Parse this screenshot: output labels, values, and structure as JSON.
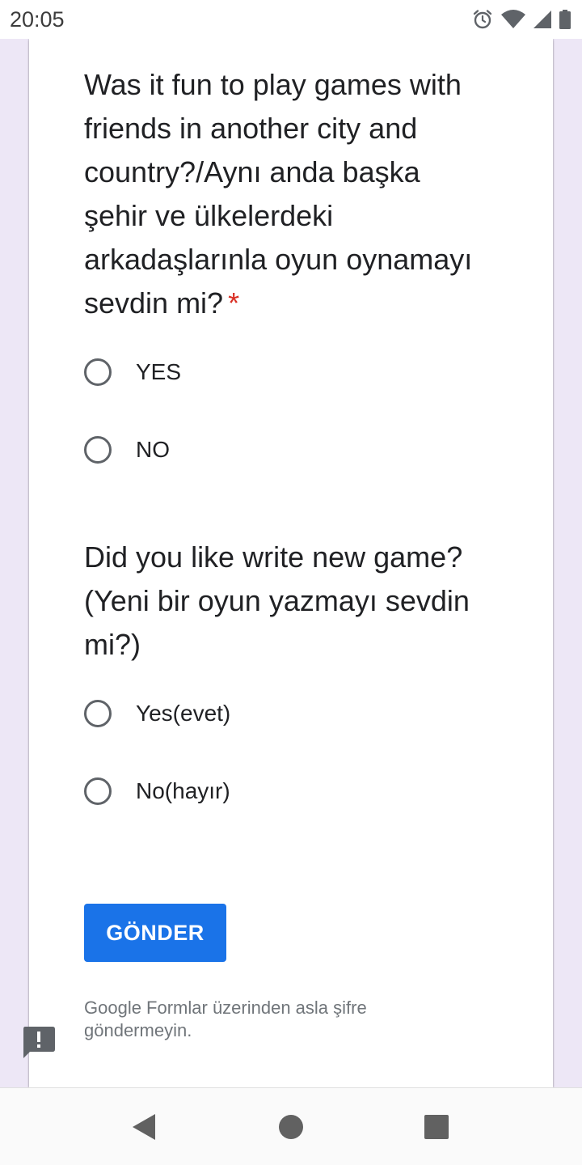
{
  "status_bar": {
    "time": "20:05",
    "icons": [
      "alarm-icon",
      "wifi-icon",
      "cell-signal-icon",
      "battery-icon"
    ]
  },
  "form": {
    "questions": [
      {
        "title": "Was it fun to play games with friends in another city and country?/Aynı anda başka şehir ve ülkelerdeki arkadaşlarınla oyun oynamayı sevdin mi?",
        "required_marker": "*",
        "options": [
          "YES",
          "NO"
        ]
      },
      {
        "title": "Did you like write new game?(Yeni bir oyun yazmayı sevdin mi?)",
        "options": [
          "Yes(evet)",
          "No(hayır)"
        ]
      }
    ],
    "submit_label": "GÖNDER",
    "footer_note": "Google Formlar üzerinden asla şifre göndermeyin.",
    "report_icon": "report-problem-icon"
  },
  "colors": {
    "accent": "#1a73e8",
    "required": "#d93025",
    "background": "#ede7f6"
  },
  "nav_bar": {
    "icons": [
      "back-icon",
      "home-icon",
      "recents-icon"
    ]
  }
}
